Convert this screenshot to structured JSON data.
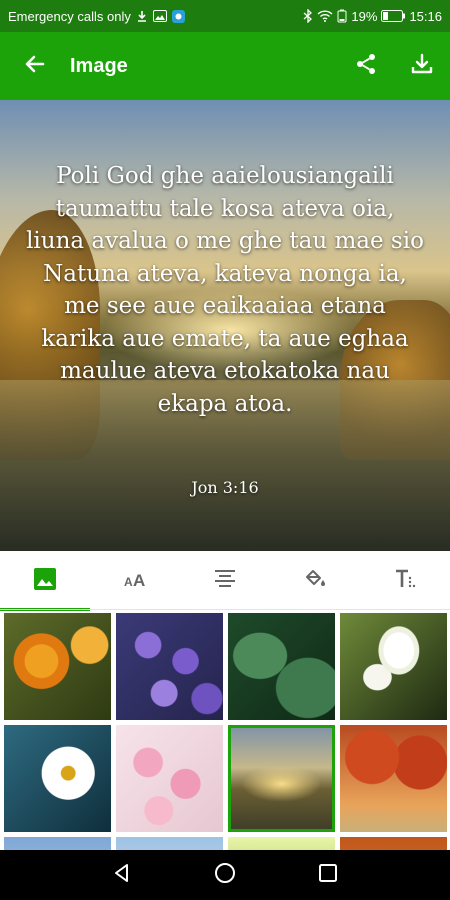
{
  "status_bar": {
    "carrier_text": "Emergency calls only",
    "battery": "19%",
    "time": "15:16"
  },
  "app_bar": {
    "title": "Image",
    "back_icon": "arrow-back-icon",
    "actions": [
      "share-icon",
      "download-icon"
    ]
  },
  "preview": {
    "verse_text": "Poli God ghe aaielousiangaili taumattu tale kosa ateva oia, liuna avalua o me ghe tau mae sio Natuna ateva, kateva nonga ia, me see aue eaikaaiaa etana karika aue emate, ta aue eghaa maulue ateva etokatoka nau ekapa atoa.",
    "reference": "Jon 3:16"
  },
  "tabs": [
    {
      "icon": "image-icon",
      "active": true
    },
    {
      "icon": "text-size-icon",
      "active": false
    },
    {
      "icon": "align-center-icon",
      "active": false
    },
    {
      "icon": "fill-color-icon",
      "active": false
    },
    {
      "icon": "text-format-icon",
      "active": false
    }
  ],
  "backgrounds": {
    "count_visible": 12,
    "selected_index": 6,
    "thumbnails": [
      "orange-flowers",
      "purple-asters",
      "green-leaves",
      "white-lilies",
      "white-daisy",
      "pink-blossoms",
      "sunset-lake",
      "autumn-trees",
      "blue-sky",
      "light-sky",
      "green-field",
      "orange-sunset"
    ]
  },
  "nav_bar": {
    "buttons": [
      "back-triangle-icon",
      "home-circle-icon",
      "recents-square-icon"
    ]
  },
  "colors": {
    "status_bar": "#1e7d0f",
    "app_bar": "#1ca30a",
    "accent": "#1ca30a"
  }
}
